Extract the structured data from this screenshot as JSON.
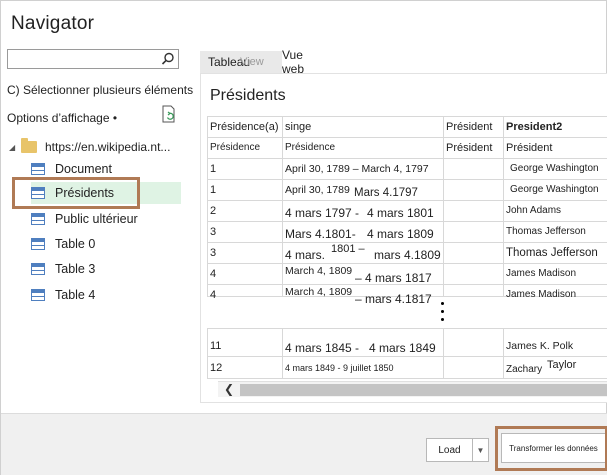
{
  "window": {
    "title": "Navigator"
  },
  "sidebar": {
    "search_placeholder": "",
    "multi_select": "C) Sélectionner plusieurs éléments",
    "display_options": "Options d’affichage •",
    "tree_root": "https://en.wikipedia.nt...",
    "items": [
      {
        "label": "Document",
        "selected": false
      },
      {
        "label": "Présidents",
        "selected": true
      },
      {
        "label": "Public ultérieur",
        "selected": false
      },
      {
        "label": "Table 0",
        "selected": false
      },
      {
        "label": "Table 3",
        "selected": false
      },
      {
        "label": "Table 4",
        "selected": false
      }
    ]
  },
  "tabs": {
    "table": "Tableau",
    "ghost": "View",
    "web": "Vue web"
  },
  "preview": {
    "title": "Présidents",
    "headers": [
      "Présidence(a)",
      "singe",
      "Président",
      "President2"
    ],
    "header_row2": [
      "Présidence",
      "Présidence",
      "Président",
      "Président"
    ],
    "rows": [
      {
        "c1": "1",
        "c2a": "April 30, 1789 – March 4, 1797",
        "c2b": "",
        "c4": "George Washington"
      },
      {
        "c1": "1",
        "c2a": "April 30, 1789",
        "c2b": "Mars 4.1797",
        "c4": "George Washington"
      },
      {
        "c1": "2",
        "c2a": "4 mars 1797 -",
        "c2b": "4 mars 1801",
        "c4": "John Adams"
      },
      {
        "c1": "3",
        "c2a": "Mars 4.1801-",
        "c2b": "4 mars 1809",
        "c4": "Thomas Jefferson"
      },
      {
        "c1": "3",
        "c2a": "4 mars.",
        "c2mid": "1801 –",
        "c2b": "mars 4.1809",
        "c4": "Thomas Jefferson"
      },
      {
        "c1": "4",
        "c2a": "March 4, 1809",
        "c2b": "– 4 mars 1817",
        "c4": "James Madison"
      },
      {
        "c1": "4",
        "c2a": "March 4, 1809",
        "c2b": "– mars 4.1817",
        "c4": "James Madison"
      }
    ],
    "rows_after": [
      {
        "c1": "11",
        "c2a": "4 mars 1845 -",
        "c2b": "4 mars 1849",
        "c4": "James K. Polk"
      },
      {
        "c1": "12",
        "c2a": "4 mars 1849 - 9 juillet 1850",
        "c2b": "",
        "c4a": "Zachary",
        "c4b": "Taylor"
      }
    ]
  },
  "footer": {
    "load": "Load",
    "transform": "Transformer les données"
  },
  "colors": {
    "highlight_box": "#b07a55",
    "selected_bg": "#dff3e4",
    "table_icon": "#4f7fbf"
  }
}
